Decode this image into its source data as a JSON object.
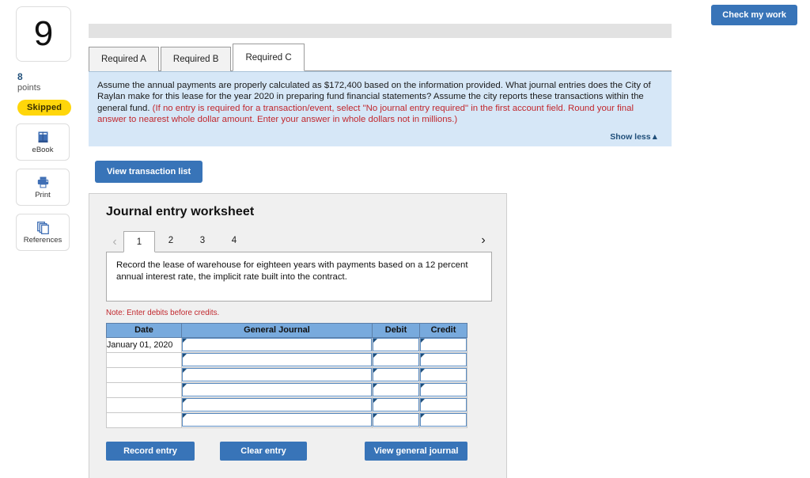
{
  "left_rail": {
    "question_number": "9",
    "points_value": "8",
    "points_label": "points",
    "status_badge": "Skipped",
    "tools": [
      {
        "label": "eBook",
        "icon": "book-icon"
      },
      {
        "label": "Print",
        "icon": "printer-icon"
      },
      {
        "label": "References",
        "icon": "copy-pages-icon"
      }
    ]
  },
  "top": {
    "check_my_work_label": "Check my work"
  },
  "tabs": [
    {
      "label": "Required A",
      "active": false
    },
    {
      "label": "Required B",
      "active": false
    },
    {
      "label": "Required C",
      "active": true
    }
  ],
  "instruction": {
    "part1": "Assume the annual payments are properly calculated as $172,400 based on the information provided.  What journal entries does the City of Raylan make for this lease for the year 2020 in preparing fund financial statements?  Assume the city reports these transactions within the general fund. ",
    "part2_red": "(If no entry is required for a transaction/event, select \"No journal entry required\" in the first account field. Round your final answer to nearest whole dollar amount. Enter your answer in whole dollars not in millions.)",
    "show_less_label": "Show less",
    "show_less_icon": "caret-up-icon"
  },
  "actions": {
    "view_transaction_list_label": "View transaction list"
  },
  "worksheet": {
    "title": "Journal entry worksheet",
    "pager": {
      "prev_icon": "chevron-left-icon",
      "next_icon": "chevron-right-icon",
      "pages": [
        "1",
        "2",
        "3",
        "4"
      ],
      "active_page": "1"
    },
    "entry_description": "Record the lease of warehouse for eighteen years with payments based on a 12 percent annual interest rate, the implicit rate built into the contract.",
    "note": "Note: Enter debits before credits.",
    "table": {
      "headers": [
        "Date",
        "General Journal",
        "Debit",
        "Credit"
      ],
      "rows": [
        {
          "date": "January 01, 2020",
          "general_journal": "",
          "debit": "",
          "credit": ""
        },
        {
          "date": "",
          "general_journal": "",
          "debit": "",
          "credit": ""
        },
        {
          "date": "",
          "general_journal": "",
          "debit": "",
          "credit": ""
        },
        {
          "date": "",
          "general_journal": "",
          "debit": "",
          "credit": ""
        },
        {
          "date": "",
          "general_journal": "",
          "debit": "",
          "credit": ""
        },
        {
          "date": "",
          "general_journal": "",
          "debit": "",
          "credit": ""
        }
      ]
    },
    "buttons": {
      "record_entry": "Record entry",
      "clear_entry": "Clear entry",
      "view_general_journal": "View general journal"
    }
  },
  "colors": {
    "accent_blue": "#3874b8",
    "instruction_panel": "#d6e7f7",
    "table_header_blue": "#78aadd",
    "alert_red": "#c1272d",
    "badge_yellow": "#ffd60a"
  }
}
